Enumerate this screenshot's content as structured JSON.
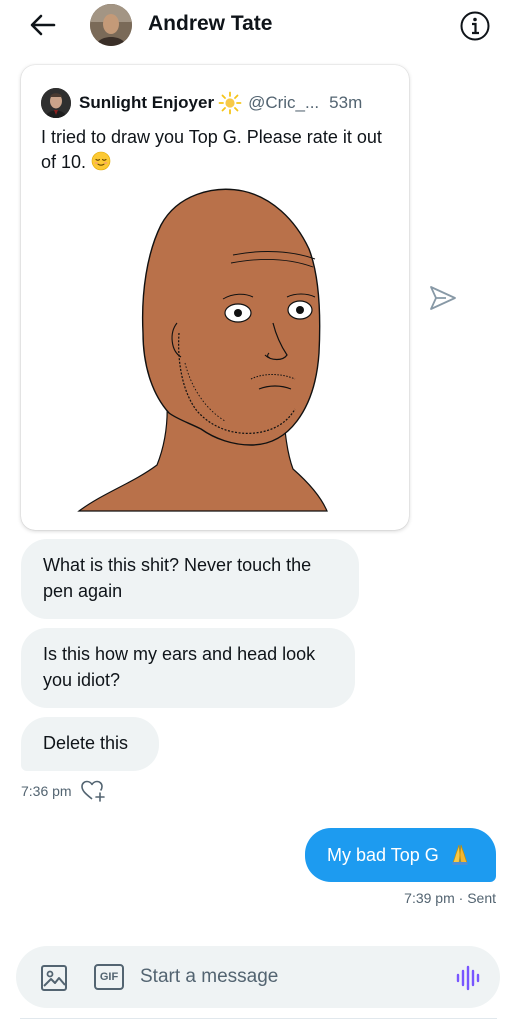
{
  "header": {
    "title": "Andrew Tate",
    "back_icon": "arrow-left-icon",
    "info_icon": "info-icon"
  },
  "quoted_tweet": {
    "author_name": "Sunlight Enjoyer",
    "author_badge_icon": "sun-icon",
    "handle": "@Cric_...",
    "time": "53m",
    "text": "I tried to draw you Top G. Please rate it out of 10.",
    "emoji_icon": "relieved-face-icon"
  },
  "messages_received": [
    {
      "text": "What is this shit? Never touch the pen again"
    },
    {
      "text": "Is this how my ears and head look you idiot?"
    },
    {
      "text": "Delete this"
    }
  ],
  "received_timestamp": "7:36 pm",
  "messages_sent": [
    {
      "text": "My bad Top G",
      "emoji_icon": "folded-hands-icon"
    }
  ],
  "sent_status": "7:39 pm · Sent",
  "composer": {
    "placeholder": "Start a message",
    "gif_label": "GIF"
  },
  "colors": {
    "accent": "#1d9bf0",
    "bubble_in": "#eff3f4",
    "secondary_text": "#536471",
    "skin": "#b9714a"
  }
}
